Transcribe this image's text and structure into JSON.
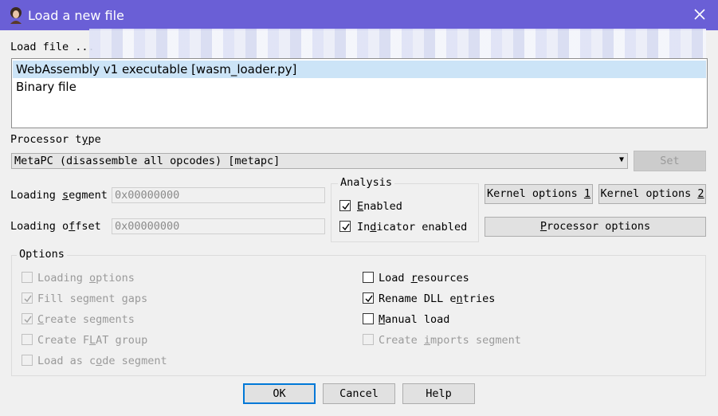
{
  "window": {
    "title": "Load a new file"
  },
  "load_file": {
    "label": "Load file ...",
    "items": [
      {
        "label": "WebAssembly v1 executable [wasm_loader.py]",
        "selected": true
      },
      {
        "label": "Binary file",
        "selected": false
      }
    ]
  },
  "processor": {
    "label": "Processor type",
    "selected": "MetaPC (disassemble all opcodes) [metapc]",
    "set_label": "Set"
  },
  "loading": {
    "segment_label": "Loading segment",
    "segment_value": "0x00000000",
    "offset_label": "Loading offset",
    "offset_value": "0x00000000"
  },
  "analysis": {
    "title": "Analysis",
    "enabled_label": "Enabled",
    "enabled_checked": true,
    "indicator_label": "Indicator enabled",
    "indicator_checked": true
  },
  "buttons": {
    "kernel1": "Kernel options 1",
    "kernel2": "Kernel options 2",
    "processor_options": "Processor options",
    "ok": "OK",
    "cancel": "Cancel",
    "help": "Help"
  },
  "options": {
    "title": "Options",
    "loading_options": "Loading options",
    "fill_segment_gaps": "Fill segment gaps",
    "create_segments": "Create segments",
    "create_flat_group": "Create FLAT group",
    "load_as_code_segment": "Load as code segment",
    "load_resources": "Load resources",
    "rename_dll_entries": "Rename DLL entries",
    "manual_load": "Manual load",
    "create_imports_segment": "Create imports segment"
  },
  "colors": {
    "titlebar": "#6a5fd6",
    "selection": "#cce4f7",
    "default_button_border": "#0078d7"
  }
}
